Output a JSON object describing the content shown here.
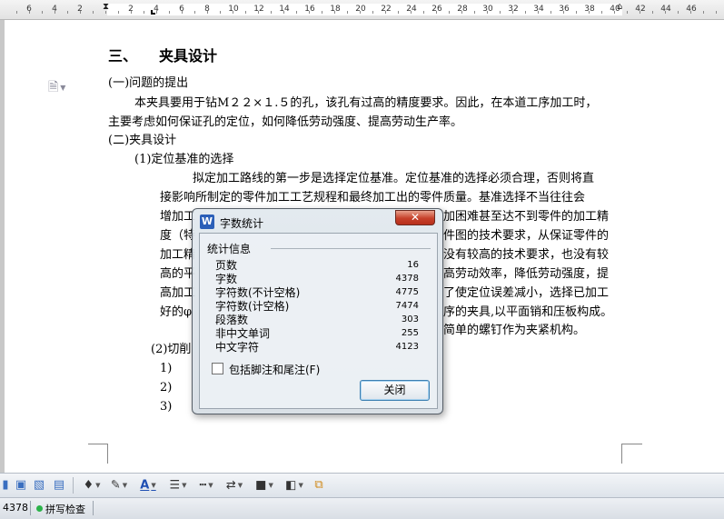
{
  "ruler": {
    "labels": [
      "6",
      "4",
      "2",
      "2",
      "4",
      "6",
      "8",
      "10",
      "12",
      "14",
      "16",
      "18",
      "20",
      "22",
      "24",
      "26",
      "28",
      "30",
      "32",
      "34",
      "36",
      "38",
      "40",
      "42",
      "44",
      "46"
    ]
  },
  "document": {
    "heading_num": "三、",
    "heading": "夹具设计",
    "p1_label": "(一)问题的提出",
    "p1_line1": "本夹具要用于钻M２２×１.５的孔，该孔有过高的精度要求。因此，在本道工序加工时，",
    "p1_line2": "主要考虑如何保证孔的定位，如何降低劳动强度、提高劳动生产率。",
    "p2_label": "(二)夹具设计",
    "p2_sub1": "(1)定位基准的选择",
    "para_lines": [
      "拟定加工路线的第一步是选择定位基准。定位基准的选择必须合理，否则将直",
      "接影响所制定的零件加工工艺规程和最终加工出的零件质量。基准选择不当往往会",
      "增加工",
      "加困难甚至达不到零件的加工精",
      "度（特",
      "件图的技术要求，从保证零件的",
      "加工精",
      "没有较高的技术要求，也没有较",
      "高的平",
      "高劳动效率，降低劳动强度，提",
      "高加工",
      "了使定位误差减小，选择已加工",
      "好的φ",
      "序的夹具,以平面销和压板构成。",
      "简单的螺钉作为夹紧机构。"
    ],
    "p2_sub2": "(2)切削",
    "list": [
      "1)",
      "2)",
      "3)"
    ]
  },
  "dialog": {
    "title": "字数统计",
    "group": "统计信息",
    "stats": [
      {
        "label": "页数",
        "value": "16"
      },
      {
        "label": "字数",
        "value": "4378"
      },
      {
        "label": "字符数(不计空格)",
        "value": "4775"
      },
      {
        "label": "字符数(计空格)",
        "value": "7474"
      },
      {
        "label": "段落数",
        "value": "303"
      },
      {
        "label": "非中文单词",
        "value": "255"
      },
      {
        "label": "中文字符",
        "value": "4123"
      }
    ],
    "checkbox_label": "包括脚注和尾注(F)",
    "close_button": "关闭"
  },
  "statusbar": {
    "word_count": "4378",
    "spell_check": "拼写检查"
  },
  "colors": {
    "accent": "#2b5fb8",
    "close_red": "#c6402a",
    "spell_ok": "#2bb34a"
  }
}
